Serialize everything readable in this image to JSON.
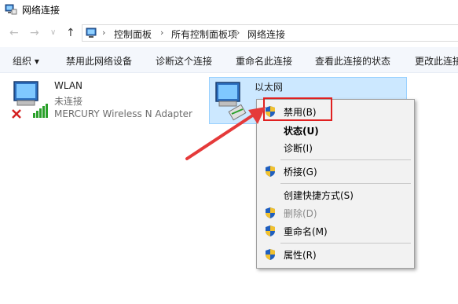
{
  "window": {
    "title": "网络连接"
  },
  "nav": {
    "back": "←",
    "forward": "→",
    "recent": "∨",
    "up": "↑"
  },
  "breadcrumb": [
    "控制面板",
    "所有控制面板项",
    "网络连接"
  ],
  "breadcrumb_sep": "›",
  "toolbar": {
    "organize": "组织 ▾",
    "disable_device": "禁用此网络设备",
    "diagnose": "诊断这个连接",
    "rename": "重命名此连接",
    "view_status": "查看此连接的状态",
    "change_settings": "更改此连接"
  },
  "connections": [
    {
      "name": "WLAN",
      "status": "未连接",
      "adapter": "MERCURY Wireless N Adapter"
    },
    {
      "name": "以太网",
      "status": "",
      "adapter": ""
    }
  ],
  "context_menu": [
    {
      "label": "禁用(B)",
      "shield": true,
      "bold": false,
      "disabled": false
    },
    {
      "label": "状态(U)",
      "shield": false,
      "bold": true,
      "disabled": false
    },
    {
      "label": "诊断(I)",
      "shield": false,
      "bold": false,
      "disabled": false
    },
    {
      "label": "桥接(G)",
      "shield": true,
      "bold": false,
      "disabled": false
    },
    {
      "label": "创建快捷方式(S)",
      "shield": false,
      "bold": false,
      "disabled": false
    },
    {
      "label": "删除(D)",
      "shield": true,
      "bold": false,
      "disabled": true
    },
    {
      "label": "重命名(M)",
      "shield": true,
      "bold": false,
      "disabled": false
    },
    {
      "label": "属性(R)",
      "shield": true,
      "bold": false,
      "disabled": false
    }
  ],
  "colors": {
    "selection": "#cce8ff",
    "annotation_red": "#e02020",
    "shield_blue": "#1f5fbf",
    "shield_yellow": "#f2c12e"
  }
}
